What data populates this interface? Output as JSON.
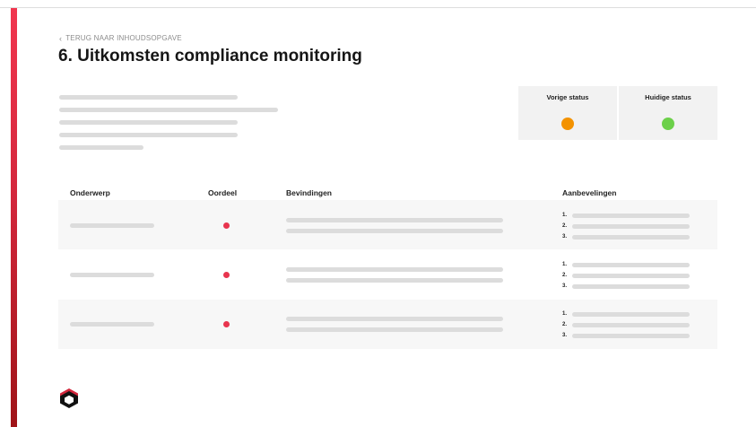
{
  "header": {
    "back_link": "TERUG NAAR INHOUDSOPGAVE",
    "back_icon": "chevron-left-icon",
    "title": "6. Uitkomsten compliance monitoring"
  },
  "status": {
    "previous": {
      "label": "Vorige status",
      "color": "#f39200"
    },
    "current": {
      "label": "Huidige status",
      "color": "#6cd04a"
    }
  },
  "table": {
    "columns": [
      "Onderwerp",
      "Oordeel",
      "Bevindingen",
      "Aanbevelingen"
    ],
    "rows": [
      {
        "oordeel_color": "#e8344e",
        "recommendation_numbers": [
          "1.",
          "2.",
          "3."
        ]
      },
      {
        "oordeel_color": "#e8344e",
        "recommendation_numbers": [
          "1.",
          "2.",
          "3."
        ]
      },
      {
        "oordeel_color": "#e8344e",
        "recommendation_numbers": [
          "1.",
          "2.",
          "3."
        ]
      }
    ]
  },
  "colors": {
    "accent_top": "#f1364f",
    "accent_bottom": "#9f1418",
    "skeleton": "#dcdcdc"
  },
  "footer": {
    "logo_icon": "hexagon-logo-icon"
  }
}
